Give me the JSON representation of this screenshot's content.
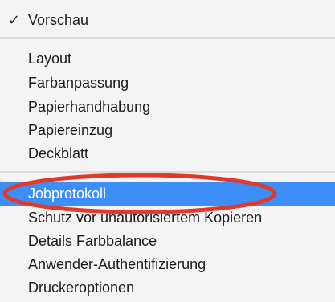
{
  "menu": {
    "items": [
      {
        "label": "Vorschau",
        "checked": true
      },
      {
        "label": "Layout"
      },
      {
        "label": "Farbanpassung"
      },
      {
        "label": "Papierhandhabung"
      },
      {
        "label": "Papiereinzug"
      },
      {
        "label": "Deckblatt"
      },
      {
        "label": "Jobprotokoll",
        "selected": true
      },
      {
        "label": "Schutz vor unautorisiertem Kopieren"
      },
      {
        "label": "Details Farbbalance"
      },
      {
        "label": "Anwender-Authentifizierung"
      },
      {
        "label": "Druckeroptionen"
      }
    ],
    "checkmark_symbol": "✓",
    "selection_color": "#3d8ef7"
  },
  "annotation": {
    "shape": "ellipse",
    "color": "#e03a2d",
    "target": "Jobprotokoll"
  }
}
